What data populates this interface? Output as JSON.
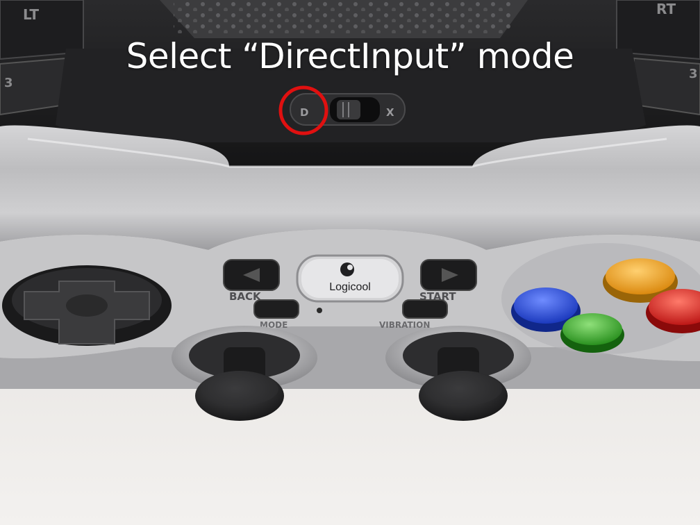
{
  "caption": "Select “DirectInput” mode",
  "controller": {
    "brand": "Logicool",
    "trigger_left": "LT",
    "trigger_right": "RT",
    "bumper_left": "3",
    "bumper_right": "3",
    "switch_left": "D",
    "switch_right": "X",
    "back_label": "BACK",
    "start_label": "START",
    "mode_label": "MODE",
    "vibration_label": "VIBRATION"
  },
  "highlight": {
    "target": "D",
    "color": "#e01010"
  },
  "face_buttons": [
    {
      "name": "blue-face-button",
      "color": "#1e3fd6"
    },
    {
      "name": "orange-face-button",
      "color": "#f0a01a"
    },
    {
      "name": "green-face-button",
      "color": "#3aa32c"
    },
    {
      "name": "red-face-button",
      "color": "#d81f1f"
    }
  ]
}
